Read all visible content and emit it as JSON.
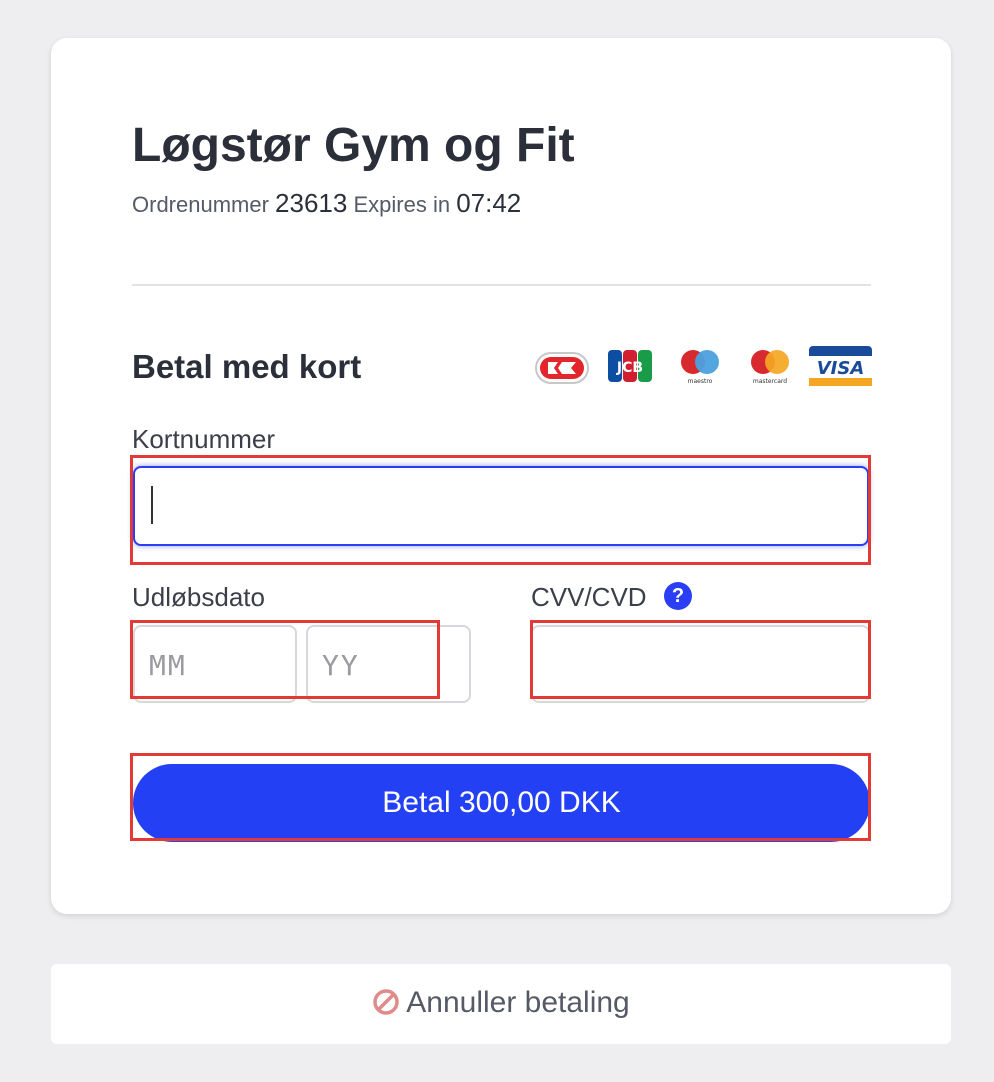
{
  "merchant": {
    "name": "Løgstør Gym og Fit",
    "order_label": "Ordrenummer",
    "order_number": "23613",
    "expires_label": "Expires in",
    "expires_time": "07:42"
  },
  "payment": {
    "section_title": "Betal med kort",
    "card_logos": [
      "dankort-icon",
      "jcb-icon",
      "maestro-icon",
      "mastercard-icon",
      "visa-icon"
    ],
    "card_number": {
      "label": "Kortnummer",
      "value": ""
    },
    "expiry": {
      "label": "Udløbsdato",
      "month_placeholder": "MM",
      "year_placeholder": "YY"
    },
    "cvv": {
      "label": "CVV/CVD",
      "help": "?",
      "value": ""
    },
    "pay_button_label": "Betal 300,00 DKK"
  },
  "cancel": {
    "label": "Annuller betaling"
  },
  "colors": {
    "accent": "#2440f5",
    "highlight": "#e23a35",
    "background": "#eeeef0"
  }
}
